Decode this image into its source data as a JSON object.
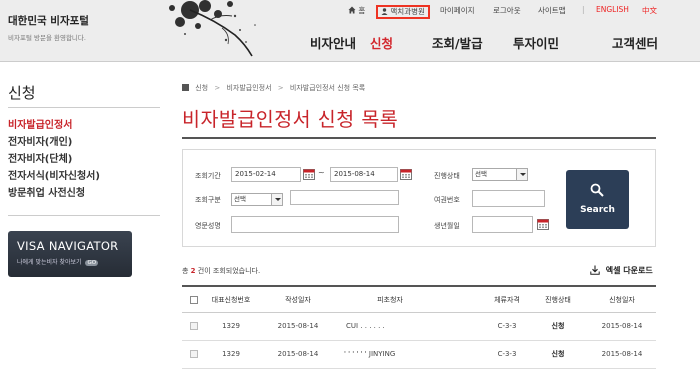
{
  "header": {
    "logo_title": "대한민국 비자포털",
    "logo_sub": "비자포털 방문을 환영합니다.",
    "top_menu": {
      "home": "홈",
      "customer": "맥치과병원",
      "mypage": "마이페이지",
      "logout": "로그아웃",
      "sitemap": "사이트맵",
      "separator": "|",
      "english": "ENGLISH",
      "chinese": "中文"
    },
    "gnb": [
      "비자안내",
      "신청",
      "조회/발급",
      "투자이민",
      "고객센터"
    ]
  },
  "sidebar": {
    "title": "신청",
    "items": [
      {
        "label": "비자발급인정서",
        "active": true
      },
      {
        "label": "전자비자(개인)",
        "active": false
      },
      {
        "label": "전자비자(단체)",
        "active": false
      },
      {
        "label": "전자서식(비자신청서)",
        "active": false
      },
      {
        "label": "방문취업 사전신청",
        "active": false
      }
    ],
    "banner": {
      "title_a": "VISA",
      "title_b": "NAVIGATOR",
      "sub": "나에게 맞는비자 찾아보기",
      "go": "GO"
    }
  },
  "breadcrumb": [
    "신청",
    "비자발급인정서",
    "비자발급인정서 신청 목록"
  ],
  "page_title": "비자발급인정서 신청 목록",
  "search": {
    "period_label": "조회기간",
    "date_from": "2015-02-14",
    "date_to": "2015-08-14",
    "tilde": "~",
    "category_label": "조회구분",
    "category_value": "선택",
    "category_text": "",
    "name_label": "영문성명",
    "name_value": "",
    "progress_label": "진행상태",
    "progress_value": "선택",
    "passport_label": "여권번호",
    "passport_value": "",
    "birth_label": "생년월일",
    "birth_value": "",
    "button_label": "Search"
  },
  "results": {
    "prefix": "총 ",
    "count": "2",
    "suffix": " 건이 조회되었습니다.",
    "excel_label": "엑셀 다운로드"
  },
  "table": {
    "headers": [
      "대표신청번호",
      "작성일자",
      "피초청자",
      "체류자격",
      "진행상태",
      "신청일자"
    ],
    "rows": [
      {
        "no": "1329",
        "written": "2015-08-14",
        "invitee": "CUI . . . . . .",
        "status": "C-3-3",
        "state": "신청",
        "applied": "2015-08-14"
      },
      {
        "no": "1329",
        "written": "2015-08-14",
        "invitee": "' ' ' ' ' ' JINYING",
        "status": "C-3-3",
        "state": "신청",
        "applied": "2015-08-14"
      }
    ]
  },
  "colors": {
    "accent_red": "#c8242a",
    "search_button": "#2c3e57",
    "banner": "#2f3640"
  }
}
